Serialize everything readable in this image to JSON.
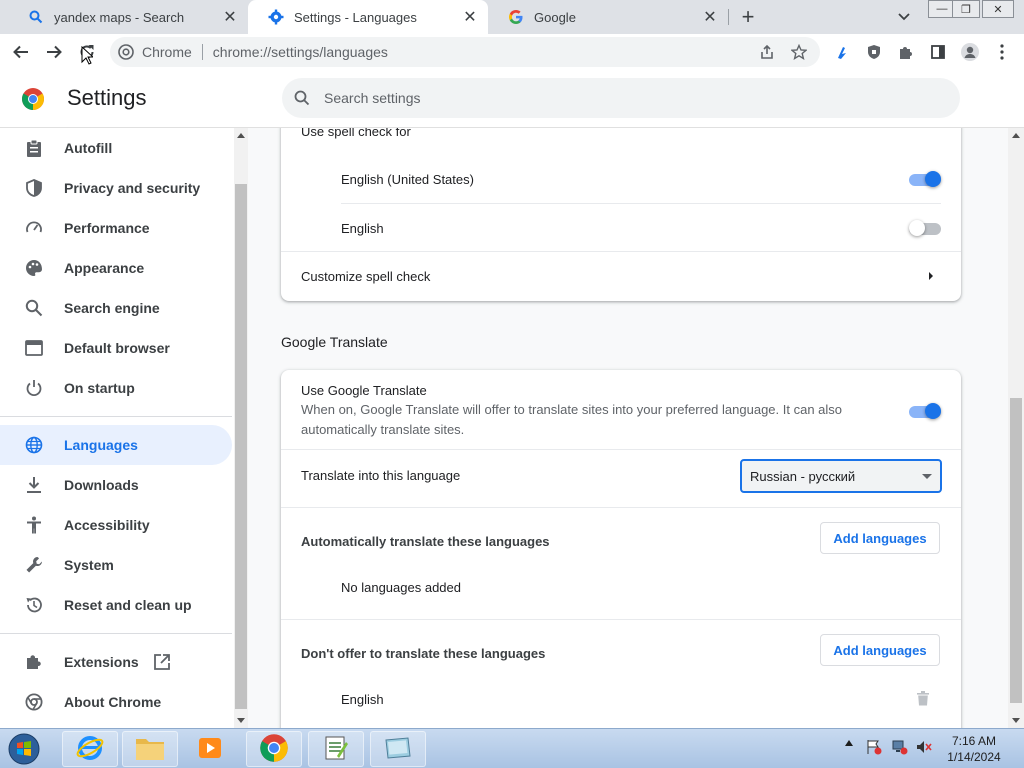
{
  "tabs": [
    {
      "title": "yandex maps - Search",
      "icon": "search-icon",
      "active": false
    },
    {
      "title": "Settings - Languages",
      "icon": "settings-gear-icon",
      "active": true
    },
    {
      "title": "Google",
      "icon": "google-g-icon",
      "active": false
    }
  ],
  "omnibox": {
    "site_label": "Chrome",
    "url": "chrome://settings/languages"
  },
  "header": {
    "title": "Settings",
    "search_placeholder": "Search settings"
  },
  "sidebar": {
    "items": [
      {
        "label": "Autofill",
        "icon": "clipboard-icon"
      },
      {
        "label": "Privacy and security",
        "icon": "shield-icon"
      },
      {
        "label": "Performance",
        "icon": "speedometer-icon"
      },
      {
        "label": "Appearance",
        "icon": "palette-icon"
      },
      {
        "label": "Search engine",
        "icon": "search-icon"
      },
      {
        "label": "Default browser",
        "icon": "browser-window-icon"
      },
      {
        "label": "On startup",
        "icon": "power-icon"
      },
      {
        "label": "Languages",
        "icon": "globe-icon",
        "active": true
      },
      {
        "label": "Downloads",
        "icon": "download-icon"
      },
      {
        "label": "Accessibility",
        "icon": "accessibility-icon"
      },
      {
        "label": "System",
        "icon": "wrench-icon"
      },
      {
        "label": "Reset and clean up",
        "icon": "history-icon"
      },
      {
        "label": "Extensions",
        "icon": "puzzle-icon"
      },
      {
        "label": "About Chrome",
        "icon": "chrome-icon"
      }
    ]
  },
  "spell_check": {
    "use_for_label": "Use spell check for",
    "languages": [
      {
        "name": "English (United States)",
        "enabled": true
      },
      {
        "name": "English",
        "enabled": false
      }
    ],
    "customize_label": "Customize spell check"
  },
  "translate": {
    "section_title": "Google Translate",
    "use_label": "Use Google Translate",
    "use_description": "When on, Google Translate will offer to translate sites into your preferred language. It can also automatically translate sites.",
    "use_enabled": true,
    "target_label": "Translate into this language",
    "target_value": "Russian - русский",
    "auto_label": "Automatically translate these languages",
    "auto_add_button": "Add languages",
    "auto_empty": "No languages added",
    "never_label": "Don't offer to translate these languages",
    "never_add_button": "Add languages",
    "never_languages": [
      "English"
    ]
  },
  "taskbar": {
    "time": "7:16 AM",
    "date": "1/14/2024"
  },
  "colors": {
    "accent": "#1a73e8",
    "active_bg": "#e8f0fe",
    "toggle_track_on": "#8ab4f8"
  }
}
